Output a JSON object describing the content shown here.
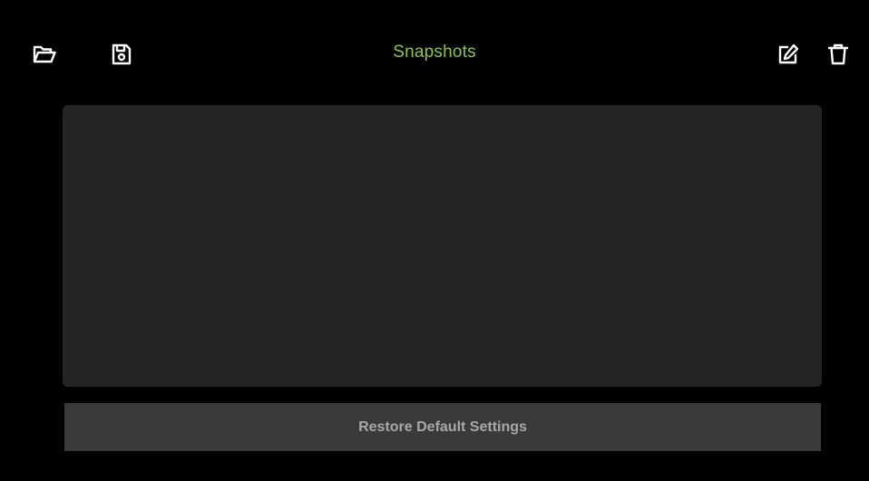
{
  "header": {
    "title": "Snapshots",
    "title_color": "#8bc34a",
    "icons": {
      "open": "folder-open-icon",
      "save": "floppy-disk-icon",
      "edit": "edit-icon",
      "delete": "trash-icon"
    }
  },
  "snapshot_list": {
    "items": []
  },
  "footer": {
    "restore_label": "Restore Default Settings"
  }
}
